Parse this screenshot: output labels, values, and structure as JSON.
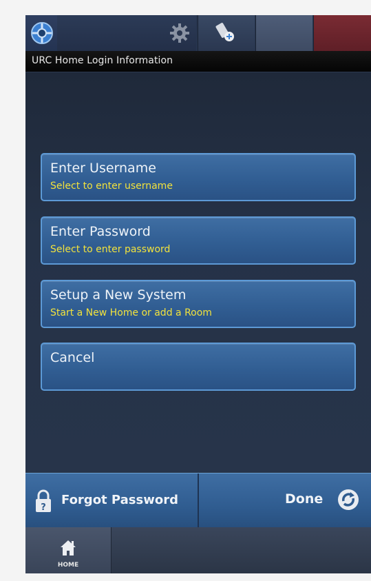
{
  "title_bar": {
    "text": "URC Home Login Information"
  },
  "top_bar": {
    "icons": [
      "urc-logo-icon",
      "gear-icon",
      "remote-select-icon"
    ],
    "colors": {
      "gray_tab": "#4e5d78",
      "red_tab": "#7a2b33"
    }
  },
  "menu": {
    "items": [
      {
        "label": "Enter Username",
        "sublabel": "Select to enter username"
      },
      {
        "label": "Enter Password",
        "sublabel": "Select to enter password"
      },
      {
        "label": "Setup a New System",
        "sublabel": "Start a New Home or add a Room"
      },
      {
        "label": "Cancel",
        "sublabel": ""
      }
    ]
  },
  "footer": {
    "forgot_label": "Forgot Password",
    "done_label": "Done"
  },
  "nav": {
    "home_label": "HOME"
  },
  "colors": {
    "button_bg": "#315e93",
    "button_border": "#5d9ad6",
    "sublabel_yellow": "#f2e23c"
  }
}
